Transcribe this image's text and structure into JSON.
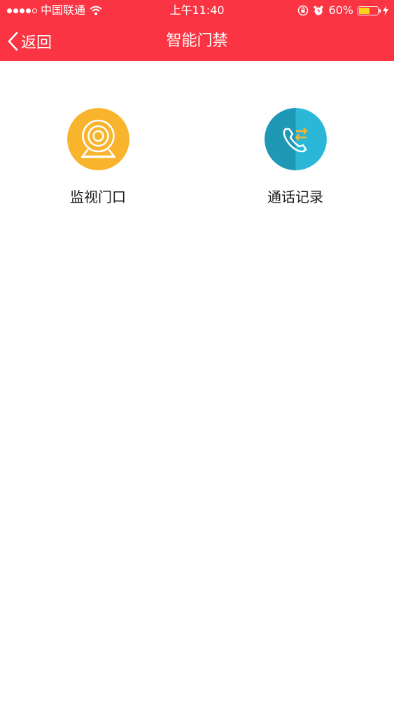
{
  "status_bar": {
    "carrier": "中国联通",
    "time": "上午11:40",
    "battery": "60%",
    "battery_level": 0.6
  },
  "nav": {
    "back_label": "返回",
    "title": "智能门禁"
  },
  "menu": {
    "items": [
      {
        "label": "监视门口",
        "icon": "webcam-icon",
        "color": "#f7b42c"
      },
      {
        "label": "通话记录",
        "icon": "phone-log-icon",
        "color": "#2bb8d8"
      }
    ]
  },
  "colors": {
    "header": "#fa3442",
    "background": "#ffffff"
  }
}
